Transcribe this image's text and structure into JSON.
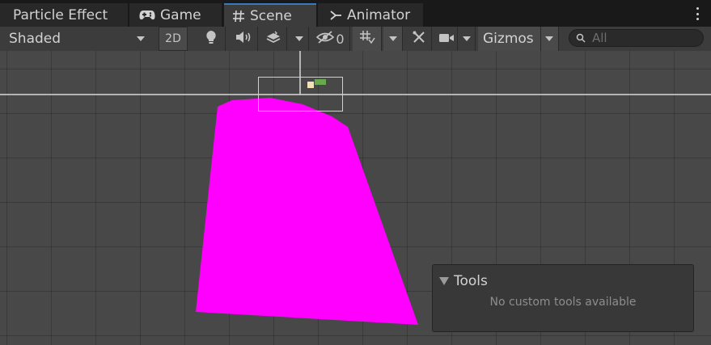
{
  "tabs": [
    {
      "label": "Particle Effect",
      "active": false
    },
    {
      "label": "Game",
      "icon": "gamepad-icon",
      "active": false
    },
    {
      "label": "Scene",
      "icon": "grid-hash-icon",
      "active": true
    },
    {
      "label": "Animator",
      "icon": "animator-icon",
      "active": false
    }
  ],
  "toolbar": {
    "shading_mode": "Shaded",
    "mode_2d_label": "2D",
    "hidden_count": "0",
    "gizmos_label": "Gizmos",
    "search_placeholder": "All"
  },
  "tools_overlay": {
    "title": "Tools",
    "message": "No custom tools available"
  },
  "colors": {
    "accent_tab": "#3a79bb",
    "mesh": "#ff00ff",
    "grid_bg": "#484848"
  }
}
